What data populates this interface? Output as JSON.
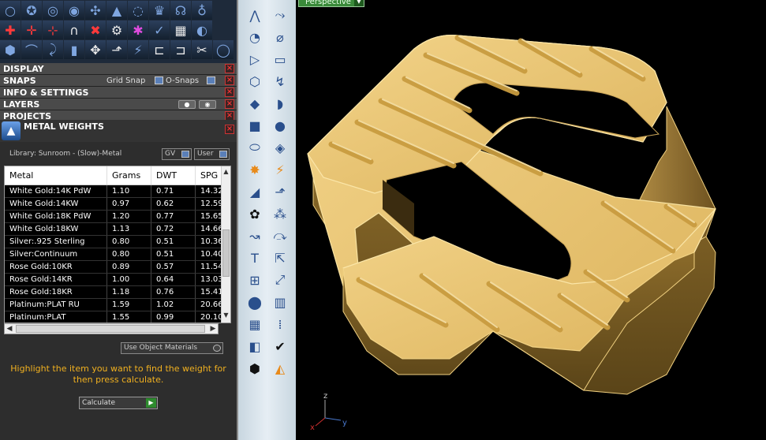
{
  "toolbar": {
    "rows": [
      [
        {
          "g": "○"
        },
        {
          "g": "✪"
        },
        {
          "g": "◎"
        },
        {
          "g": "◉"
        },
        {
          "g": "✣"
        },
        {
          "g": "▲"
        },
        {
          "g": "◌"
        },
        {
          "g": "♛"
        },
        {
          "g": "☊"
        },
        {
          "g": "♁"
        }
      ],
      [
        {
          "g": "✚",
          "c": "red"
        },
        {
          "g": "✛",
          "c": "red"
        },
        {
          "g": "⊹",
          "c": "red"
        },
        {
          "g": "∩",
          "c": "white"
        },
        {
          "g": "✖",
          "c": "red"
        },
        {
          "g": "⚙",
          "c": "white"
        },
        {
          "g": "✱",
          "c": "mag"
        },
        {
          "g": "✓"
        },
        {
          "g": "▦",
          "c": "white"
        },
        {
          "g": "◐"
        }
      ],
      [
        {
          "g": "⬢"
        },
        {
          "g": "⌒"
        },
        {
          "g": "⤸"
        },
        {
          "g": "▮"
        },
        {
          "g": "✥",
          "c": "white"
        },
        {
          "g": "⬏",
          "c": "white"
        },
        {
          "g": "⚡"
        },
        {
          "g": "⊏",
          "c": "white"
        },
        {
          "g": "⊐",
          "c": "white"
        },
        {
          "g": "✂",
          "c": "white"
        },
        {
          "g": "◯"
        }
      ]
    ]
  },
  "sections": {
    "display": "DISPLAY",
    "snaps": "SNAPS",
    "grid_snap": "Grid Snap",
    "o_snaps": "O-Snaps",
    "info": "INFO & SETTINGS",
    "layers": "LAYERS",
    "projects": "PROJECTS",
    "close": "×"
  },
  "metal_weights": {
    "title": "METAL WEIGHTS",
    "library": "Library: Sunroom - (Slow)-Metal",
    "gv": "GV",
    "user": "User",
    "columns": [
      "Metal",
      "Grams",
      "DWT",
      "SPG"
    ],
    "rows": [
      [
        "White Gold:14K PdW",
        "1.10",
        "0.71",
        "14.32"
      ],
      [
        "White Gold:14KW",
        "0.97",
        "0.62",
        "12.59"
      ],
      [
        "White Gold:18K PdW",
        "1.20",
        "0.77",
        "15.65"
      ],
      [
        "White Gold:18KW",
        "1.13",
        "0.72",
        "14.66"
      ],
      [
        "Silver:.925 Sterling",
        "0.80",
        "0.51",
        "10.36"
      ],
      [
        "Silver:Continuum",
        "0.80",
        "0.51",
        "10.40"
      ],
      [
        "Rose Gold:10KR",
        "0.89",
        "0.57",
        "11.54"
      ],
      [
        "Rose Gold:14KR",
        "1.00",
        "0.64",
        "13.03"
      ],
      [
        "Rose Gold:18KR",
        "1.18",
        "0.76",
        "15.41"
      ],
      [
        "Platinum:PLAT RU",
        "1.59",
        "1.02",
        "20.66"
      ],
      [
        "Platinum:PLAT",
        "1.55",
        "0.99",
        "20.10"
      ]
    ],
    "use_object_materials": "Use Object Materials",
    "instruction": "Highlight the item you want to find the weight for then press calculate.",
    "calculate": "Calculate"
  },
  "tools": {
    "left": [
      {
        "g": "⋀"
      },
      {
        "g": "◔"
      },
      {
        "g": "▷"
      },
      {
        "g": "⬡"
      },
      {
        "g": "◆"
      },
      {
        "g": "■"
      },
      {
        "g": "⬭"
      },
      {
        "g": "✸",
        "c": "orange"
      },
      {
        "g": "◢"
      },
      {
        "g": "✿",
        "c": "black"
      },
      {
        "g": "↝"
      },
      {
        "g": "T"
      },
      {
        "g": "⊞"
      },
      {
        "g": "⬤"
      },
      {
        "g": "▦"
      },
      {
        "g": "◧"
      },
      {
        "g": "⬢",
        "c": "black"
      }
    ],
    "right": [
      {
        "g": "⤳"
      },
      {
        "g": "⌀"
      },
      {
        "g": "▭"
      },
      {
        "g": "↯"
      },
      {
        "g": "◗"
      },
      {
        "g": "●"
      },
      {
        "g": "◈"
      },
      {
        "g": "⚡",
        "c": "orange"
      },
      {
        "g": "⬏"
      },
      {
        "g": "⁂"
      },
      {
        "g": "⤼"
      },
      {
        "g": "⇱"
      },
      {
        "g": "⤢"
      },
      {
        "g": "▥"
      },
      {
        "g": "⁞"
      },
      {
        "g": "✔",
        "c": "black"
      },
      {
        "g": "◭",
        "c": "orange"
      }
    ]
  },
  "viewport": {
    "view_name": "Perspective",
    "axis_z": "z",
    "axis_y": "y",
    "axis_x": "x",
    "colors": {
      "model": "#e8c16a",
      "model_shade": "#a8843a",
      "background": "#000000"
    }
  }
}
